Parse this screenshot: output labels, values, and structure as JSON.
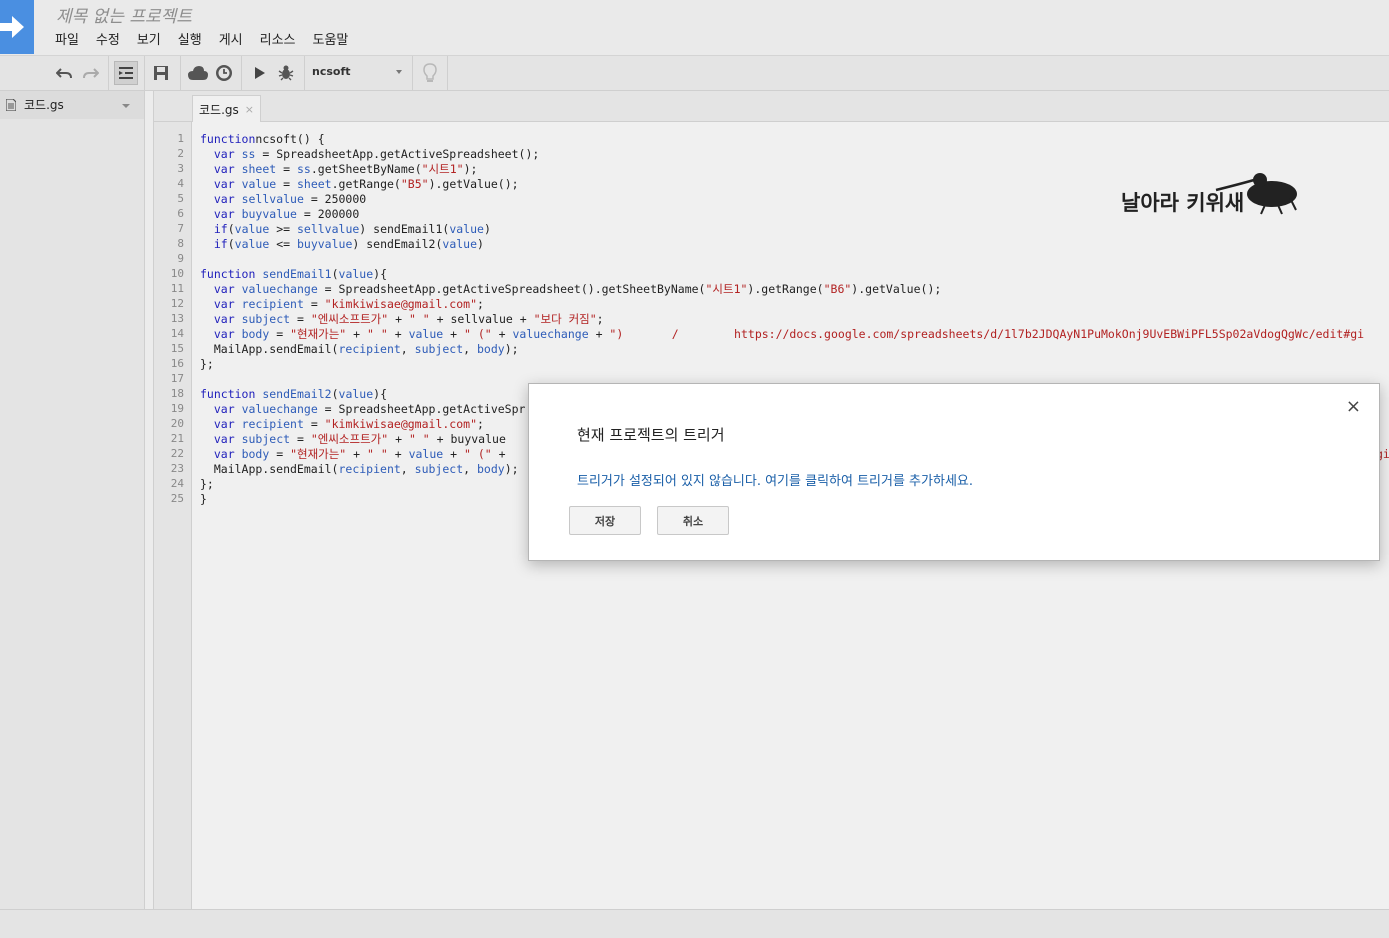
{
  "app": {
    "project_title": "제목 없는 프로젝트",
    "menu": [
      "파일",
      "수정",
      "보기",
      "실행",
      "게시",
      "리소스",
      "도움말"
    ]
  },
  "toolbar": {
    "function_select": "ncsoft",
    "icons": [
      "undo-icon",
      "redo-icon",
      "indent-icon",
      "save-icon",
      "cloud-deploy-icon",
      "clock-trigger-icon",
      "run-icon",
      "debug-icon",
      "lightbulb-icon"
    ]
  },
  "sidebar": {
    "file_name": "코드.gs"
  },
  "editor": {
    "tab_label": "코드.gs",
    "tab_close": "×",
    "line_numbers": [
      "1",
      "2",
      "3",
      "4",
      "5",
      "6",
      "7",
      "8",
      "9",
      "10",
      "11",
      "12",
      "13",
      "14",
      "15",
      "16",
      "17",
      "18",
      "19",
      "20",
      "21",
      "22",
      "23",
      "24",
      "25"
    ],
    "lines": [
      [
        [
          "kw",
          "function"
        ],
        [
          "",
          "ncsoft() {"
        ]
      ],
      [
        [
          "",
          "  "
        ],
        [
          "kw",
          "var"
        ],
        [
          "",
          " "
        ],
        [
          "vr",
          "ss"
        ],
        [
          "",
          " = SpreadsheetApp.getActiveSpreadsheet();"
        ]
      ],
      [
        [
          "",
          "  "
        ],
        [
          "kw",
          "var"
        ],
        [
          "",
          " "
        ],
        [
          "vr",
          "sheet"
        ],
        [
          "",
          " = "
        ],
        [
          "vr",
          "ss"
        ],
        [
          "",
          ".getSheetByName("
        ],
        [
          "st",
          "\"시트1\""
        ],
        [
          "",
          ");"
        ]
      ],
      [
        [
          "",
          "  "
        ],
        [
          "kw",
          "var"
        ],
        [
          "",
          " "
        ],
        [
          "vr",
          "value"
        ],
        [
          "",
          " = "
        ],
        [
          "vr",
          "sheet"
        ],
        [
          "",
          ".getRange("
        ],
        [
          "st",
          "\"B5\""
        ],
        [
          "",
          ").getValue();"
        ]
      ],
      [
        [
          "",
          "  "
        ],
        [
          "kw",
          "var"
        ],
        [
          "",
          " "
        ],
        [
          "vr",
          "sellvalue"
        ],
        [
          "",
          " = 250000"
        ]
      ],
      [
        [
          "",
          "  "
        ],
        [
          "kw",
          "var"
        ],
        [
          "",
          " "
        ],
        [
          "vr",
          "buyvalue"
        ],
        [
          "",
          " = 200000"
        ]
      ],
      [
        [
          "",
          "  "
        ],
        [
          "kw",
          "if"
        ],
        [
          "",
          "("
        ],
        [
          "vr",
          "value"
        ],
        [
          "",
          " >= "
        ],
        [
          "vr",
          "sellvalue"
        ],
        [
          "",
          ") sendEmail1("
        ],
        [
          "vr",
          "value"
        ],
        [
          "",
          ")"
        ]
      ],
      [
        [
          "",
          "  "
        ],
        [
          "kw",
          "if"
        ],
        [
          "",
          "("
        ],
        [
          "vr",
          "value"
        ],
        [
          "",
          " <= "
        ],
        [
          "vr",
          "buyvalue"
        ],
        [
          "",
          ") sendEmail2("
        ],
        [
          "vr",
          "value"
        ],
        [
          "",
          ")"
        ]
      ],
      [
        [
          "",
          ""
        ]
      ],
      [
        [
          "kw",
          "function"
        ],
        [
          "",
          " "
        ],
        [
          "vr",
          "sendEmail1"
        ],
        [
          "",
          "("
        ],
        [
          "vr",
          "value"
        ],
        [
          "",
          "){"
        ]
      ],
      [
        [
          "",
          "  "
        ],
        [
          "kw",
          "var"
        ],
        [
          "",
          " "
        ],
        [
          "vr",
          "valuechange"
        ],
        [
          "",
          " = SpreadsheetApp.getActiveSpreadsheet().getSheetByName("
        ],
        [
          "st",
          "\"시트1\""
        ],
        [
          "",
          ").getRange("
        ],
        [
          "st",
          "\"B6\""
        ],
        [
          "",
          ").getValue();"
        ]
      ],
      [
        [
          "",
          "  "
        ],
        [
          "kw",
          "var"
        ],
        [
          "",
          " "
        ],
        [
          "vr",
          "recipient"
        ],
        [
          "",
          " = "
        ],
        [
          "st",
          "\"kimkiwisae@gmail.com\""
        ],
        [
          "",
          ";"
        ]
      ],
      [
        [
          "",
          "  "
        ],
        [
          "kw",
          "var"
        ],
        [
          "",
          " "
        ],
        [
          "vr",
          "subject"
        ],
        [
          "",
          " = "
        ],
        [
          "st",
          "\"엔씨소프트가\""
        ],
        [
          "",
          " + "
        ],
        [
          "st",
          "\" \""
        ],
        [
          "",
          " + sellvalue + "
        ],
        [
          "st",
          "\"보다 커짐\""
        ],
        [
          "",
          ";"
        ]
      ],
      [
        [
          "",
          "  "
        ],
        [
          "kw",
          "var"
        ],
        [
          "",
          " "
        ],
        [
          "vr",
          "body"
        ],
        [
          "",
          " = "
        ],
        [
          "st",
          "\"현재가는\""
        ],
        [
          "",
          " + "
        ],
        [
          "st",
          "\" \""
        ],
        [
          "",
          " + "
        ],
        [
          "vr",
          "value"
        ],
        [
          "",
          " + "
        ],
        [
          "st",
          "\" (\""
        ],
        [
          "",
          " + "
        ],
        [
          "vr",
          "valuechange"
        ],
        [
          "",
          " + "
        ],
        [
          "st",
          "\")       /        https://docs.google.com/spreadsheets/d/1l7b2JDQAyN1PuMokOnj9UvEBWiPFL5Sp02aVdogQgWc/edit#gi"
        ]
      ],
      [
        [
          "",
          "  MailApp.sendEmail("
        ],
        [
          "vr",
          "recipient"
        ],
        [
          "",
          ", "
        ],
        [
          "vr",
          "subject"
        ],
        [
          "",
          ", "
        ],
        [
          "vr",
          "body"
        ],
        [
          "",
          ");"
        ]
      ],
      [
        [
          "",
          "};"
        ]
      ],
      [
        [
          "",
          ""
        ]
      ],
      [
        [
          "kw",
          "function"
        ],
        [
          "",
          " "
        ],
        [
          "vr",
          "sendEmail2"
        ],
        [
          "",
          "("
        ],
        [
          "vr",
          "value"
        ],
        [
          "",
          "){"
        ]
      ],
      [
        [
          "",
          "  "
        ],
        [
          "kw",
          "var"
        ],
        [
          "",
          " "
        ],
        [
          "vr",
          "valuechange"
        ],
        [
          "",
          " = SpreadsheetApp.getActiveSpr"
        ]
      ],
      [
        [
          "",
          "  "
        ],
        [
          "kw",
          "var"
        ],
        [
          "",
          " "
        ],
        [
          "vr",
          "recipient"
        ],
        [
          "",
          " = "
        ],
        [
          "st",
          "\"kimkiwisae@gmail.com\""
        ],
        [
          "",
          ";"
        ]
      ],
      [
        [
          "",
          "  "
        ],
        [
          "kw",
          "var"
        ],
        [
          "",
          " "
        ],
        [
          "vr",
          "subject"
        ],
        [
          "",
          " = "
        ],
        [
          "st",
          "\"엔씨소프트가\""
        ],
        [
          "",
          " + "
        ],
        [
          "st",
          "\" \""
        ],
        [
          "",
          " + buyvalue"
        ]
      ],
      [
        [
          "",
          "  "
        ],
        [
          "kw",
          "var"
        ],
        [
          "",
          " "
        ],
        [
          "vr",
          "body"
        ],
        [
          "",
          " = "
        ],
        [
          "st",
          "\"현재가는\""
        ],
        [
          "",
          " + "
        ],
        [
          "st",
          "\" \""
        ],
        [
          "",
          " + "
        ],
        [
          "vr",
          "value"
        ],
        [
          "",
          " + "
        ],
        [
          "st",
          "\" (\""
        ],
        [
          "",
          " +"
        ]
      ],
      [
        [
          "",
          "  MailApp.sendEmail("
        ],
        [
          "vr",
          "recipient"
        ],
        [
          "",
          ", "
        ],
        [
          "vr",
          "subject"
        ],
        [
          "",
          ", "
        ],
        [
          "vr",
          "body"
        ],
        [
          "",
          ");"
        ]
      ],
      [
        [
          "",
          "};"
        ]
      ],
      [
        [
          "",
          "}"
        ]
      ]
    ],
    "right_edge_fragment": "gi"
  },
  "watermark": {
    "text": "날아라 키위새"
  },
  "dialog": {
    "title": "현재 프로젝트의 트리거",
    "close": "×",
    "message": "트리거가 설정되어 있지 않습니다. 여기를 클릭하여 트리거를 추가하세요.",
    "save_label": "저장",
    "cancel_label": "취소"
  }
}
